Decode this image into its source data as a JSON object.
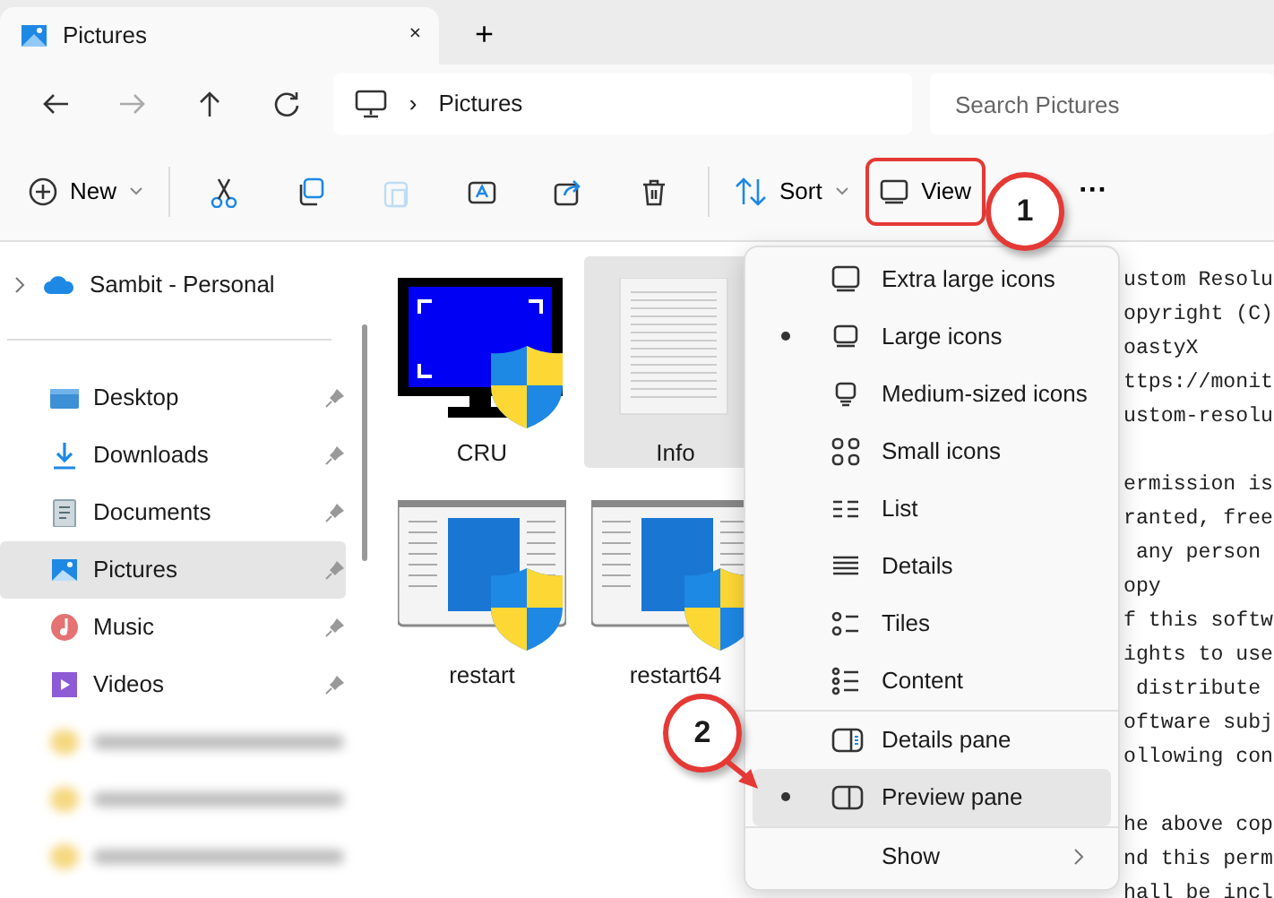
{
  "window": {
    "tab_title": "Pictures",
    "tab_close": "×",
    "new_tab": "+"
  },
  "address_bar": {
    "path": [
      "Pictures"
    ],
    "separator": "›",
    "search_placeholder": "Search Pictures"
  },
  "toolbar": {
    "new_label": "New",
    "icon_buttons": [
      {
        "disabled": false
      },
      {
        "disabled": false
      },
      {
        "disabled": true
      },
      {
        "disabled": false
      },
      {
        "disabled": false
      },
      {
        "disabled": false
      }
    ],
    "sort_label": "Sort",
    "view_label": "View",
    "view_highlighted": true,
    "more": "···"
  },
  "sidebar": {
    "cloud": {
      "label": "Sambit - Personal",
      "expanded": false
    },
    "items": [
      {
        "kind": "folder",
        "label": "Desktop",
        "pinned": true,
        "selected": false
      },
      {
        "kind": "folder",
        "label": "Downloads",
        "pinned": true,
        "selected": false
      },
      {
        "kind": "folder",
        "label": "Documents",
        "pinned": true,
        "selected": false
      },
      {
        "kind": "folder",
        "label": "Pictures",
        "pinned": true,
        "selected": true
      },
      {
        "kind": "folder",
        "label": "Music",
        "pinned": true,
        "selected": false
      },
      {
        "kind": "folder",
        "label": "Videos",
        "pinned": true,
        "selected": false
      },
      {
        "kind": "blurred"
      },
      {
        "kind": "blurred"
      },
      {
        "kind": "blurred"
      }
    ]
  },
  "files": [
    {
      "kind": "monitor",
      "name": "CRU",
      "selected": false
    },
    {
      "kind": "document",
      "name": "Info",
      "selected": true
    },
    {
      "kind": "app",
      "name": "restart",
      "selected": false
    },
    {
      "kind": "app",
      "name": "restart64",
      "selected": false
    }
  ],
  "preview_pane": {
    "paragraphs": [
      [
        "ustom Resolu",
        "opyright (C)",
        "oastyX",
        "ttps://monit",
        "ustom-resolu"
      ],
      [
        "ermission is",
        "ranted, free",
        " any person",
        "opy",
        "f this softw",
        "ights to use",
        " distribute",
        "oftware subj",
        "ollowing con"
      ],
      [
        "he above cop",
        "nd this perm",
        "hall be incl"
      ]
    ]
  },
  "view_menu": {
    "items": [
      {
        "kind": "option",
        "label": "Extra large icons",
        "selected": false,
        "hovered": false
      },
      {
        "kind": "option",
        "label": "Large icons",
        "selected": true,
        "hovered": false
      },
      {
        "kind": "option",
        "label": "Medium-sized icons",
        "selected": false,
        "hovered": false
      },
      {
        "kind": "option",
        "label": "Small icons",
        "selected": false,
        "hovered": false
      },
      {
        "kind": "option",
        "label": "List",
        "selected": false,
        "hovered": false
      },
      {
        "kind": "option",
        "label": "Details",
        "selected": false,
        "hovered": false
      },
      {
        "kind": "option",
        "label": "Tiles",
        "selected": false,
        "hovered": false
      },
      {
        "kind": "option",
        "label": "Content",
        "selected": false,
        "hovered": false
      },
      {
        "kind": "divider"
      },
      {
        "kind": "pane",
        "label": "Details pane",
        "selected": false,
        "hovered": false
      },
      {
        "kind": "pane",
        "label": "Preview pane",
        "selected": true,
        "hovered": true
      },
      {
        "kind": "divider"
      },
      {
        "kind": "submenu",
        "label": "Show",
        "selected": false,
        "hovered": false
      }
    ]
  },
  "annotations": [
    {
      "label": "1"
    },
    {
      "label": "2"
    }
  ]
}
